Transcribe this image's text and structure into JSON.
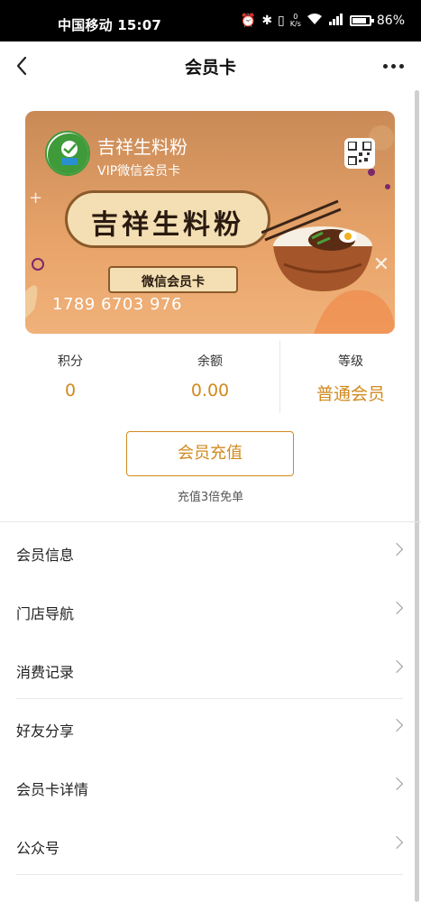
{
  "status_bar": {
    "carrier_time": "中国移动 15:07",
    "net_speed_top": "0",
    "net_speed_unit": "K/s",
    "battery_percent": "86%",
    "battery_level": 0.86
  },
  "header": {
    "title": "会员卡",
    "back_icon": "chevron-left-icon",
    "more_icon": "more-icon"
  },
  "card": {
    "store_name": "吉祥生料粉",
    "card_type": "VIP微信会员卡",
    "brand_banner": "吉祥生料粉",
    "ribbon": "微信会员卡",
    "card_number": "1789 6703 976",
    "colors": {
      "card_top": "#c98a57",
      "card_bottom": "#f0b27a"
    }
  },
  "stats": [
    {
      "label": "积分",
      "value": "0"
    },
    {
      "label": "余额",
      "value": "0.00"
    },
    {
      "label": "等级",
      "value": "普通会员"
    }
  ],
  "recharge": {
    "button_label": "会员充值",
    "note": "充值3倍免单",
    "accent_color": "#d08a1e"
  },
  "menu": [
    {
      "label": "会员信息"
    },
    {
      "label": "门店导航"
    },
    {
      "label": "消费记录"
    },
    {
      "label": "好友分享"
    },
    {
      "label": "会员卡详情"
    },
    {
      "label": "公众号"
    }
  ]
}
